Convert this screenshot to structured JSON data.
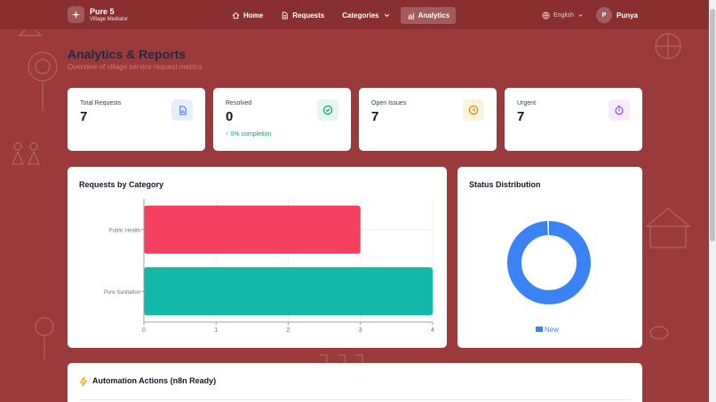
{
  "brand": {
    "title": "Pure 5",
    "subtitle": "Village Mediator"
  },
  "nav": {
    "home": "Home",
    "requests": "Requests",
    "categories": "Categories",
    "analytics": "Analytics"
  },
  "language": "English",
  "user": {
    "initial": "P",
    "name": "Punya"
  },
  "page": {
    "title": "Analytics & Reports",
    "subtitle": "Overview of village service request metrics"
  },
  "stats": {
    "total": {
      "label": "Total Requests",
      "value": "7"
    },
    "resolved": {
      "label": "Resolved",
      "value": "0",
      "note": "↑ 0% completion"
    },
    "open": {
      "label": "Open Issues",
      "value": "7"
    },
    "urgent": {
      "label": "Urgent",
      "value": "7"
    }
  },
  "category_panel": {
    "title": "Requests by Category"
  },
  "status_panel": {
    "title": "Status Distribution"
  },
  "automation_panel": {
    "title": "Automation Actions (n8n Ready)"
  },
  "colors": {
    "background": "#9a3a3a",
    "nav": "#8a2f2f",
    "public_health": "#f43f5e",
    "pure_sanitation": "#14b8a6",
    "status_new": "#3b82f6"
  },
  "chart_data": [
    {
      "type": "bar",
      "orientation": "horizontal",
      "categories": [
        "Public Health",
        "Pure Sanitation"
      ],
      "values": [
        3,
        4
      ],
      "bar_colors": [
        "#f43f5e",
        "#14b8a6"
      ],
      "xlim": [
        0,
        4
      ],
      "xticks": [
        "0",
        "1",
        "2",
        "3",
        "4"
      ],
      "grid": true
    },
    {
      "type": "pie",
      "variant": "doughnut",
      "labels": [
        "New"
      ],
      "values": [
        7
      ],
      "colors": [
        "#3b82f6"
      ],
      "legend": "bottom"
    }
  ]
}
